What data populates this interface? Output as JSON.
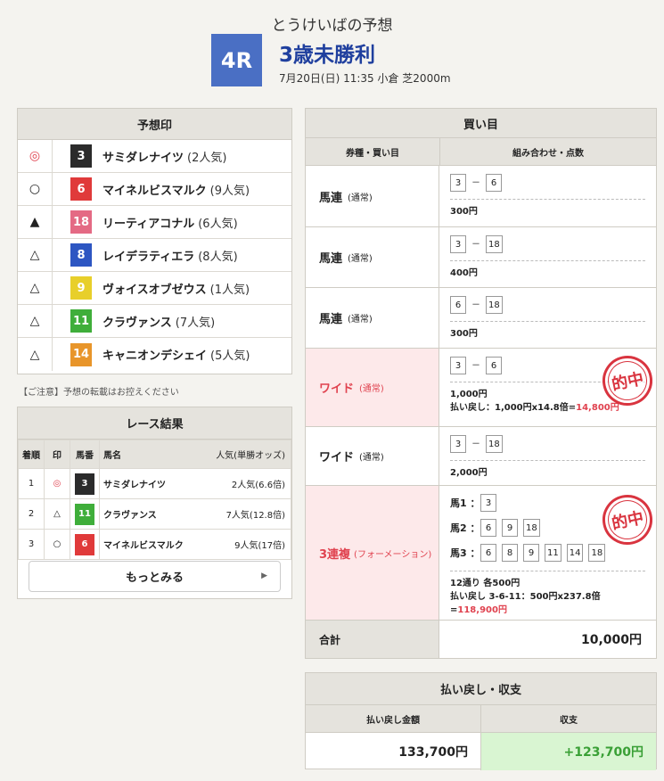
{
  "header": {
    "title": "とうけいばの予想",
    "race_no": "4R",
    "race_name": "3歳未勝利",
    "meta": "7月20日(日) 11:35 小倉 芝2000m"
  },
  "prediction": {
    "title": "予想印",
    "rows": [
      {
        "mark": "◎",
        "num": "3",
        "name": "サミダレナイツ",
        "pop": "(2人気)",
        "bg": "#2b2b2b",
        "fg": "#ffffff"
      },
      {
        "mark": "○",
        "num": "6",
        "name": "マイネルビスマルク",
        "pop": "(9人気)",
        "bg": "#e03a3a",
        "fg": "#ffffff"
      },
      {
        "mark": "▲",
        "num": "18",
        "name": "リーティアコナル",
        "pop": "(6人気)",
        "bg": "#e46a84",
        "fg": "#ffffff"
      },
      {
        "mark": "△",
        "num": "8",
        "name": "レイデラティエラ",
        "pop": "(8人気)",
        "bg": "#2d56c2",
        "fg": "#ffffff"
      },
      {
        "mark": "△",
        "num": "9",
        "name": "ヴォイスオブゼウス",
        "pop": "(1人気)",
        "bg": "#e8cf2a",
        "fg": "#ffffff"
      },
      {
        "mark": "△",
        "num": "11",
        "name": "クラヴァンス",
        "pop": "(7人気)",
        "bg": "#3fae3a",
        "fg": "#ffffff"
      },
      {
        "mark": "△",
        "num": "14",
        "name": "キャニオンデシェイ",
        "pop": "(5人気)",
        "bg": "#e8952a",
        "fg": "#ffffff"
      }
    ],
    "note": "【ご注意】予想の転載はお控えください"
  },
  "results": {
    "title": "レース結果",
    "headers": {
      "rank": "着順",
      "mark": "印",
      "num": "馬番",
      "name": "馬名",
      "pop": "人気(単勝オッズ)"
    },
    "rows": [
      {
        "rank": "1",
        "mark": "◎",
        "num": "3",
        "name": "サミダレナイツ",
        "pop": "2人気(6.6倍)",
        "bg": "#2b2b2b"
      },
      {
        "rank": "2",
        "mark": "△",
        "num": "11",
        "name": "クラヴァンス",
        "pop": "7人気(12.8倍)",
        "bg": "#3fae3a"
      },
      {
        "rank": "3",
        "mark": "○",
        "num": "6",
        "name": "マイネルビスマルク",
        "pop": "9人気(17倍)",
        "bg": "#e03a3a"
      }
    ],
    "more_label": "もっとみる"
  },
  "bets": {
    "title": "買い目",
    "col1": "券種・買い目",
    "col2": "組み合わせ・点数",
    "rows": [
      {
        "type": "馬連",
        "sub": "(通常)",
        "nums": [
          "3",
          "6"
        ],
        "amount": "300円",
        "hit": false
      },
      {
        "type": "馬連",
        "sub": "(通常)",
        "nums": [
          "3",
          "18"
        ],
        "amount": "400円",
        "hit": false
      },
      {
        "type": "馬連",
        "sub": "(通常)",
        "nums": [
          "6",
          "18"
        ],
        "amount": "300円",
        "hit": false
      },
      {
        "type": "ワイド",
        "sub": "(通常)",
        "nums": [
          "3",
          "6"
        ],
        "amount": "1,000円",
        "hit": true,
        "payout_label": "払い戻し：1,000円x14.8倍=",
        "payout_value": "14,800円"
      },
      {
        "type": "ワイド",
        "sub": "(通常)",
        "nums": [
          "3",
          "18"
        ],
        "amount": "2,000円",
        "hit": false
      }
    ],
    "formation": {
      "type": "3連複",
      "sub": "(フォーメーション)",
      "lines": [
        {
          "label": "馬1",
          "nums": [
            "3"
          ]
        },
        {
          "label": "馬2",
          "nums": [
            "6",
            "9",
            "18"
          ]
        },
        {
          "label": "馬3",
          "nums": [
            "6",
            "8",
            "9",
            "11",
            "14",
            "18"
          ]
        }
      ],
      "amount": "12通り 各500円",
      "payout_label": "払い戻し 3-6-11：500円x237.8倍=",
      "payout_value": "118,900円"
    },
    "stamp_text": "的中",
    "total_label": "合計",
    "total_value": "10,000円"
  },
  "summary": {
    "title": "払い戻し・収支",
    "col1": "払い戻し金額",
    "col2": "収支",
    "payout": "133,700円",
    "balance": "+123,700円"
  }
}
